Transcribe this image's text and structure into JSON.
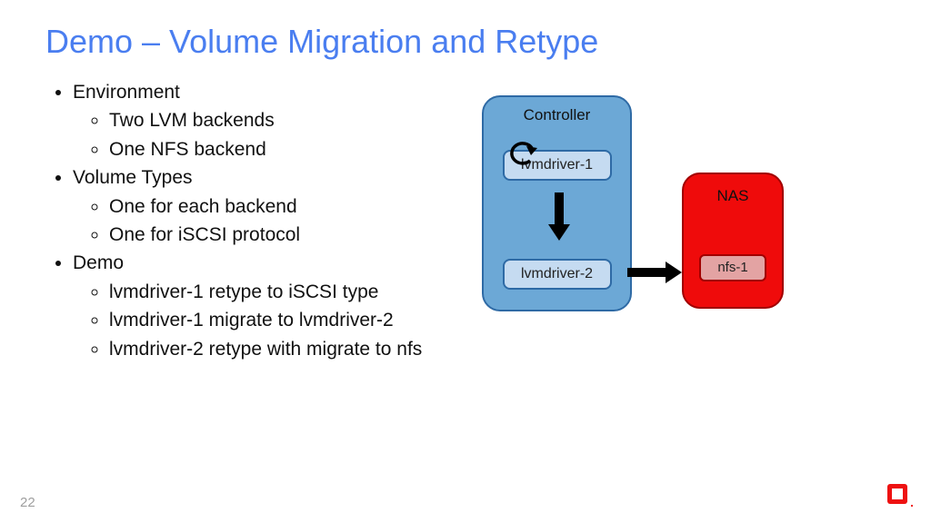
{
  "title": "Demo – Volume Migration and Retype",
  "bullets": {
    "b1": "Environment",
    "b1a": "Two LVM backends",
    "b1b": "One NFS backend",
    "b2": "Volume Types",
    "b2a": "One for each backend",
    "b2b": "One for iSCSI protocol",
    "b3": "Demo",
    "b3a": "lvmdriver-1 retype to iSCSI type",
    "b3b": "lvmdriver-1 migrate to lvmdriver-2",
    "b3c": "lvmdriver-2 retype with migrate to nfs"
  },
  "diagram": {
    "controller_label": "Controller",
    "lvm1": "lvmdriver-1",
    "lvm2": "lvmdriver-2",
    "nas_label": "NAS",
    "nfs": "nfs-1"
  },
  "page_number": "22"
}
